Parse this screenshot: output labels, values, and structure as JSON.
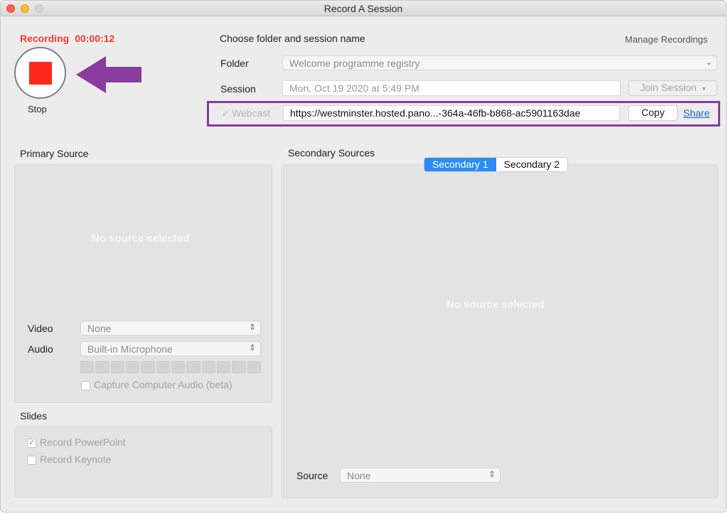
{
  "window": {
    "title": "Record A Session"
  },
  "recording": {
    "status_label": "Recording",
    "elapsed": "00:00:12",
    "stop_label": "Stop"
  },
  "session_form": {
    "heading": "Choose folder and session name",
    "manage_link": "Manage Recordings",
    "folder_label": "Folder",
    "folder_value": "Welcome programme registry",
    "session_label": "Session",
    "session_placeholder": "Mon, Oct 19 2020 at 5:49 PM",
    "join_button": "Join Session",
    "webcast_label": "Webcast",
    "webcast_checked": true,
    "webcast_url": "https://westminster.hosted.pano...-364a-46fb-b868-ac5901163dae",
    "copy_button": "Copy",
    "share_link": "Share"
  },
  "primary_source": {
    "heading": "Primary Source",
    "placeholder": "No source selected",
    "video_label": "Video",
    "video_value": "None",
    "audio_label": "Audio",
    "audio_value": "Built-in Microphone",
    "capture_audio_label": "Capture Computer Audio (beta)",
    "capture_audio_checked": false
  },
  "slides": {
    "heading": "Slides",
    "record_powerpoint_label": "Record PowerPoint",
    "record_powerpoint_checked": true,
    "record_keynote_label": "Record Keynote",
    "record_keynote_checked": false
  },
  "secondary_sources": {
    "heading": "Secondary Sources",
    "tabs": [
      {
        "label": "Secondary 1",
        "active": true
      },
      {
        "label": "Secondary 2",
        "active": false
      }
    ],
    "placeholder": "No source selected",
    "source_label": "Source",
    "source_value": "None"
  },
  "icons": {
    "stop": "stop-square-icon",
    "pointer_arrow": "left-arrow-icon",
    "dropdown": "chevron-down-icon",
    "stepper": "up-down-chevron-icon",
    "check": "checkmark-icon"
  },
  "colors": {
    "recording_red": "#fb3a2d",
    "stop_square": "#fd2a1a",
    "annotation_purple": "#8a3b9e",
    "tab_active_blue": "#2c8cf4",
    "share_link_blue": "#1a67d0"
  }
}
